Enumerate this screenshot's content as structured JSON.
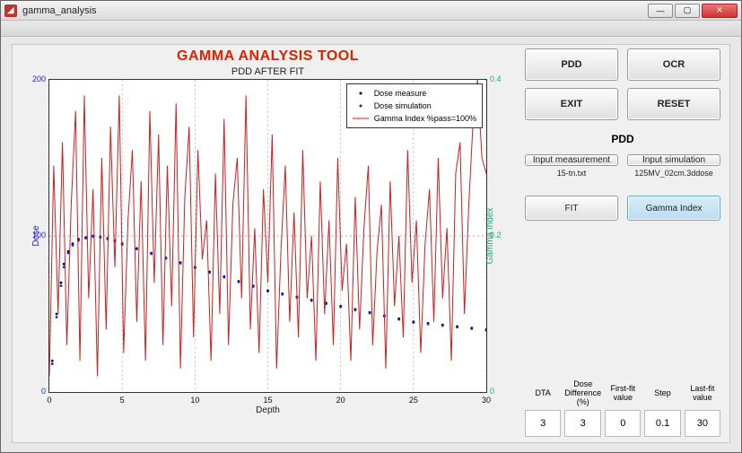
{
  "window": {
    "title": "gamma_analysis"
  },
  "app_title": "GAMMA ANALYSIS TOOL",
  "chart_data": {
    "type": "line",
    "title": "PDD AFTER FIT",
    "xlabel": "Depth",
    "ylabel_left": "Dose",
    "ylabel_right": "Gamma Index",
    "xlim": [
      0,
      30
    ],
    "ylim_left": [
      0,
      200
    ],
    "ylim_right": [
      0,
      0.4
    ],
    "xticks": [
      0,
      5,
      10,
      15,
      20,
      25,
      30
    ],
    "yticks_left": [
      0,
      100,
      200
    ],
    "yticks_right": [
      0,
      0.2,
      0.4
    ],
    "series": [
      {
        "name": "Dose measure",
        "kind": "dots",
        "color": "#000000",
        "x": [
          0.2,
          0.5,
          0.8,
          1.0,
          1.3,
          1.6,
          2.0,
          2.5,
          3.0,
          3.5,
          4.0,
          4.5,
          5,
          6,
          7,
          8,
          9,
          10,
          11,
          12,
          13,
          14,
          15,
          16,
          17,
          18,
          19,
          20,
          21,
          22,
          23,
          24,
          25,
          26,
          27,
          28,
          29,
          30
        ],
        "y": [
          20,
          50,
          70,
          82,
          90,
          95,
          98,
          99,
          100,
          99.5,
          98.5,
          97,
          95,
          92,
          89,
          86,
          83,
          80,
          77,
          74,
          71,
          68,
          65,
          63,
          61,
          59,
          57,
          55,
          53,
          51,
          49,
          47,
          45,
          44,
          43,
          42,
          41,
          40
        ]
      },
      {
        "name": "Dose simulation",
        "kind": "dots",
        "color": "#1020e0",
        "x": [
          0.2,
          0.5,
          0.8,
          1.0,
          1.3,
          1.6,
          2.0,
          2.5,
          3.0,
          3.5,
          4.0,
          4.5,
          5,
          6,
          7,
          8,
          9,
          10,
          11,
          12,
          13,
          14,
          15,
          16,
          17,
          18,
          19,
          20,
          21,
          22,
          23,
          24,
          25,
          26,
          27,
          28,
          29,
          30
        ],
        "y": [
          18,
          48,
          68,
          80,
          89,
          94,
          97,
          98.5,
          99.5,
          99,
          98,
          96.5,
          94.5,
          91.5,
          88.5,
          85.5,
          82.5,
          79.5,
          76.5,
          73.5,
          70.5,
          67.5,
          64.5,
          62.5,
          60.5,
          58.5,
          56.5,
          54.5,
          52.5,
          50.5,
          48.5,
          46.5,
          44.5,
          43.5,
          42.5,
          41.5,
          40.5,
          39.5
        ]
      },
      {
        "name": "Gamma Index %pass=100%",
        "kind": "line",
        "color": "#cc2222",
        "axis": "right",
        "x": [
          0,
          0.3,
          0.6,
          0.9,
          1.2,
          1.5,
          1.8,
          2.1,
          2.4,
          2.7,
          3,
          3.3,
          3.6,
          3.9,
          4.2,
          4.5,
          4.8,
          5.1,
          5.4,
          5.7,
          6,
          6.3,
          6.6,
          6.9,
          7.2,
          7.5,
          7.8,
          8.1,
          8.4,
          8.7,
          9,
          9.3,
          9.6,
          9.9,
          10.2,
          10.5,
          10.8,
          11.1,
          11.4,
          11.7,
          12,
          12.3,
          12.6,
          12.9,
          13.2,
          13.5,
          13.8,
          14.1,
          14.4,
          14.7,
          15,
          15.3,
          15.6,
          15.9,
          16.2,
          16.5,
          16.8,
          17.1,
          17.4,
          17.7,
          18,
          18.3,
          18.6,
          18.9,
          19.2,
          19.5,
          19.8,
          20.1,
          20.4,
          20.7,
          21,
          21.3,
          21.6,
          21.9,
          22.2,
          22.5,
          22.8,
          23.1,
          23.4,
          23.7,
          24,
          24.3,
          24.6,
          24.9,
          25.2,
          25.5,
          25.8,
          26.1,
          26.4,
          26.7,
          27,
          27.3,
          27.6,
          27.9,
          28.2,
          28.5,
          28.8,
          29.1,
          29.4,
          29.7,
          30
        ],
        "y": [
          0.02,
          0.29,
          0.1,
          0.32,
          0.06,
          0.24,
          0.36,
          0.04,
          0.38,
          0.12,
          0.26,
          0.02,
          0.3,
          0.08,
          0.34,
          0.16,
          0.38,
          0.05,
          0.22,
          0.31,
          0.09,
          0.27,
          0.04,
          0.36,
          0.14,
          0.33,
          0.06,
          0.29,
          0.11,
          0.37,
          0.03,
          0.25,
          0.34,
          0.07,
          0.31,
          0.17,
          0.22,
          0.04,
          0.28,
          0.1,
          0.35,
          0.06,
          0.24,
          0.3,
          0.12,
          0.38,
          0.08,
          0.21,
          0.05,
          0.26,
          0.14,
          0.33,
          0.03,
          0.18,
          0.29,
          0.09,
          0.23,
          0.07,
          0.31,
          0.12,
          0.2,
          0.04,
          0.27,
          0.1,
          0.22,
          0.06,
          0.3,
          0.13,
          0.19,
          0.04,
          0.25,
          0.08,
          0.21,
          0.29,
          0.06,
          0.18,
          0.24,
          0.03,
          0.27,
          0.11,
          0.2,
          0.07,
          0.31,
          0.14,
          0.22,
          0.05,
          0.19,
          0.26,
          0.09,
          0.3,
          0.12,
          0.21,
          0.04,
          0.28,
          0.32,
          0.1,
          0.24,
          0.35,
          0.4,
          0.3,
          0.28
        ]
      }
    ]
  },
  "legend": {
    "items": [
      "Dose measure",
      "Dose simulation",
      "Gamma Index %pass=100%"
    ]
  },
  "buttons": {
    "pdd": "PDD",
    "ocr": "OCR",
    "exit": "EXIT",
    "reset": "RESET",
    "fit": "FIT",
    "gamma": "Gamma Index",
    "input_meas": "Input measurement",
    "input_sim": "Input simulation"
  },
  "section_label": "PDD",
  "files": {
    "measurement": "15-tn.txt",
    "simulation": "125MV_02cm.3ddose"
  },
  "params": {
    "headers": [
      "DTA",
      "Dose Difference (%)",
      "First-fit value",
      "Step",
      "Last-fit value"
    ],
    "values": [
      "3",
      "3",
      "0",
      "0.1",
      "30"
    ]
  }
}
